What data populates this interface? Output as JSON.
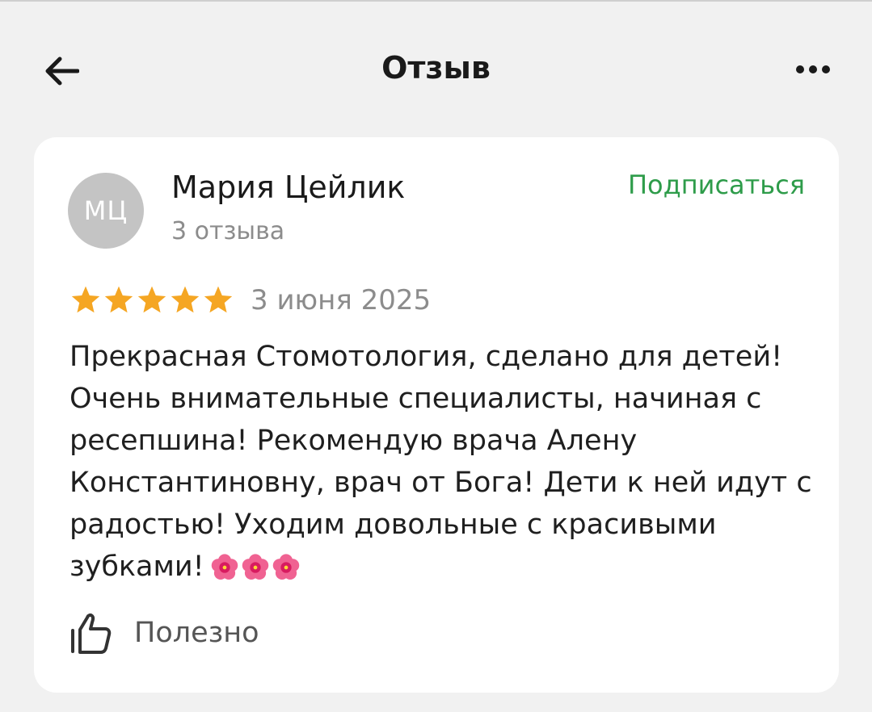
{
  "header": {
    "back_icon": "arrow-left-icon",
    "title": "Отзыв",
    "more_icon": "more-horizontal-icon"
  },
  "review": {
    "author": {
      "initials": "МЦ",
      "name": "Мария Цейлик",
      "reviews_count": "3 отзыва"
    },
    "subscribe_label": "Подписаться",
    "rating": 5,
    "rating_max": 5,
    "date": "3 июня 2025",
    "text": "Прекрасная Стомотология, сделано для детей! Очень внимательные специалисты, начиная с ресепшина! Рекомендую врача Алену Константиновну, врач от Бога! Дети к ней идут с радостью! Уходим довольные с красивыми зубками!",
    "emoji": [
      "🌺",
      "🌺",
      "🌺"
    ],
    "helpful_label": "Полезно",
    "helpful_icon": "thumbs-up-icon"
  },
  "colors": {
    "background": "#f1f1f1",
    "card": "#ffffff",
    "accent_green": "#2e9c4a",
    "star": "#f5a623",
    "muted_text": "#8c8c8c",
    "avatar_bg": "#c4c4c4"
  }
}
